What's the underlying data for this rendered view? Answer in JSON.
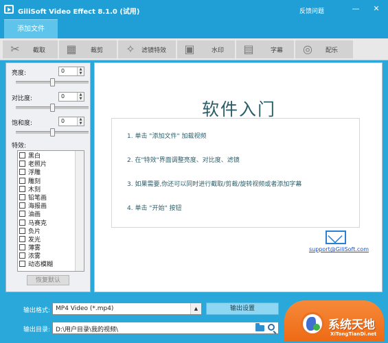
{
  "window": {
    "title": "GiliSoft Video Effect 8.1.0 (试用)",
    "feedback": "反馈问题",
    "minimize": "—",
    "close": "✕"
  },
  "tabs": {
    "add_file": "添加文件"
  },
  "toolbar": [
    {
      "label": "截取",
      "icon": "scissors-icon",
      "glyph": "✂"
    },
    {
      "label": "裁剪",
      "icon": "film-crop-icon",
      "glyph": "▦"
    },
    {
      "label": "滤镜特效",
      "icon": "sparkle-icon",
      "glyph": "✧"
    },
    {
      "label": "水印",
      "icon": "image-watermark-icon",
      "glyph": "▣"
    },
    {
      "label": "字幕",
      "icon": "subtitle-film-icon",
      "glyph": "▤"
    },
    {
      "label": "配乐",
      "icon": "music-disc-icon",
      "glyph": "◎"
    }
  ],
  "adjustments": {
    "brightness": {
      "label": "亮度:",
      "value": "0",
      "level": 0.5
    },
    "contrast": {
      "label": "对比度:",
      "value": "0",
      "level": 0.5
    },
    "saturation": {
      "label": "饱和度:",
      "value": "0",
      "level": 0.5
    }
  },
  "effects": {
    "label": "特效:",
    "items": [
      "黑白",
      "老照片",
      "浮雕",
      "雕刻",
      "木刻",
      "铅笔画",
      "海报画",
      "油画",
      "马赛克",
      "负片",
      "发光",
      "薄雾",
      "浓雾",
      "动态模糊"
    ],
    "restore_button": "恢复默认"
  },
  "guide": {
    "title": "软件入门",
    "steps": [
      "1. 单击 \"添加文件\" 加载视频",
      "2. 在\"特效\"界面调整亮度、对比度、滤镜",
      "3. 如果需要,你还可以同时进行截取/剪裁/旋转视频或者添加字幕",
      "4. 单击 \"开始\" 按钮"
    ],
    "support_email": "support@GiliSoft.com"
  },
  "output": {
    "format_label": "输出格式:",
    "format_value": "MP4 Video (*.mp4)",
    "settings_button": "输出设置",
    "dir_label": "输出目录:",
    "dir_value": "D:\\用户目录\\我的视频\\"
  },
  "watermark": {
    "text": "系统天地",
    "url": "XiTongTianDi.net"
  },
  "colors": {
    "title_bar": "#1f9fd5",
    "accent": "#5ec4eb",
    "start_button": "#ef6a14"
  }
}
